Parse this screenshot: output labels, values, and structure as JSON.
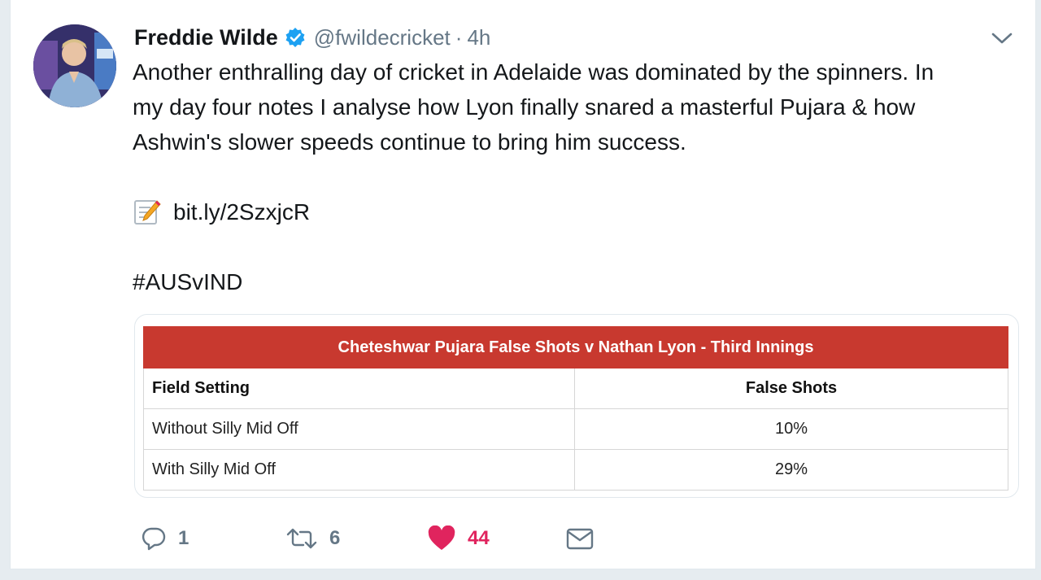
{
  "author": {
    "name": "Freddie Wilde",
    "handle": "@fwildecricket",
    "separator": "·",
    "time": "4h"
  },
  "tweet": {
    "lines": [
      "Another enthralling day of cricket in Adelaide was dominated by the spinners. In",
      "my day four notes I analyse how Lyon finally snared a masterful Pujara & how",
      "Ashwin's slower speeds continue to bring him success."
    ],
    "link": "bit.ly/2SzxjcR",
    "hashtag": "#AUSvIND"
  },
  "table": {
    "title": "Cheteshwar Pujara False Shots v Nathan Lyon - Third Innings",
    "headers": [
      "Field Setting",
      "False Shots"
    ],
    "rows": [
      [
        "Without Silly Mid Off",
        "10%"
      ],
      [
        "With Silly Mid Off",
        "29%"
      ]
    ]
  },
  "actions": {
    "replies": "1",
    "retweets": "6",
    "likes": "44"
  },
  "colors": {
    "like": "#e0245e",
    "verified": "#1da1f2",
    "table_header": "#c8392f"
  },
  "icons": [
    "verified-badge-icon",
    "chevron-down-icon",
    "memo-icon",
    "reply-icon",
    "retweet-icon",
    "heart-icon",
    "message-icon"
  ]
}
